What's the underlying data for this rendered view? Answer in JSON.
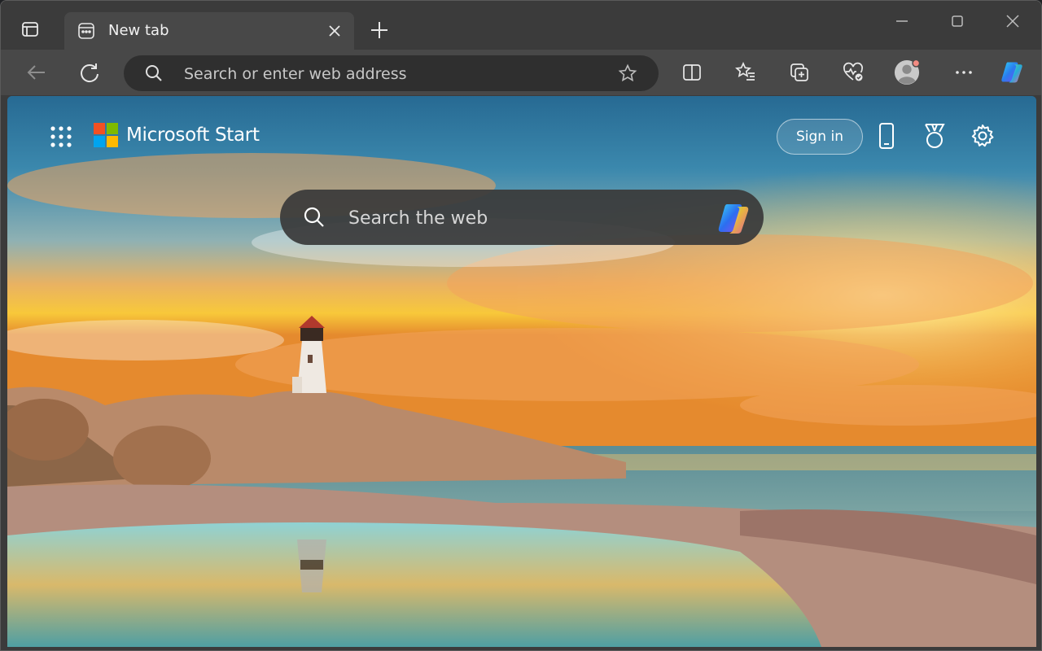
{
  "tab": {
    "title": "New tab"
  },
  "toolbar": {
    "address_placeholder": "Search or enter web address"
  },
  "new_tab_page": {
    "brand": "Microsoft Start",
    "sign_in": "Sign in",
    "search_placeholder": "Search the web"
  },
  "icons": {
    "tab_actions": "tab-actions-icon",
    "favicon": "new-tab-favicon",
    "back": "back-arrow-icon",
    "refresh": "refresh-icon",
    "star": "star-icon",
    "split": "split-screen-icon",
    "favorites": "favorites-icon",
    "collections": "collections-icon",
    "health": "browser-essentials-icon",
    "profile": "profile-avatar-icon",
    "more": "more-icon",
    "copilot": "copilot-icon",
    "apps": "apps-grid-icon",
    "phone": "phone-icon",
    "rewards": "rewards-medal-icon",
    "settings": "gear-icon"
  },
  "colors": {
    "ms_red": "#f25022",
    "ms_green": "#7fba00",
    "ms_blue": "#00a4ef",
    "ms_yellow": "#ffb900",
    "chrome_dark": "#3b3b3b",
    "toolbar": "#484848"
  }
}
